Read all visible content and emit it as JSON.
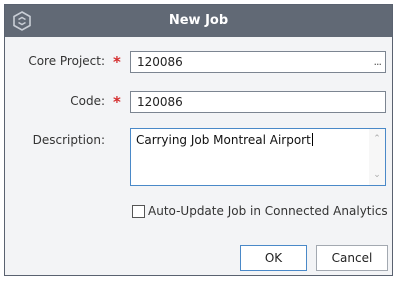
{
  "dialog": {
    "title": "New Job"
  },
  "form": {
    "core_project": {
      "label": "Core Project:",
      "required_mark": "*",
      "value": "120086",
      "browse_button": "..."
    },
    "code": {
      "label": "Code:",
      "required_mark": "*",
      "value": "120086"
    },
    "description": {
      "label": "Description:",
      "value": "Carrying Job Montreal Airport"
    },
    "auto_update": {
      "label": "Auto-Update Job in Connected Analytics",
      "checked": false
    }
  },
  "buttons": {
    "ok": "OK",
    "cancel": "Cancel"
  },
  "colors": {
    "titlebar": "#616975",
    "required": "#d42b2b",
    "focus_border": "#4a89c8"
  },
  "icons": {
    "logo": "app-logo-icon",
    "scroll_up": "chevron-up-icon",
    "scroll_down": "chevron-down-icon"
  }
}
